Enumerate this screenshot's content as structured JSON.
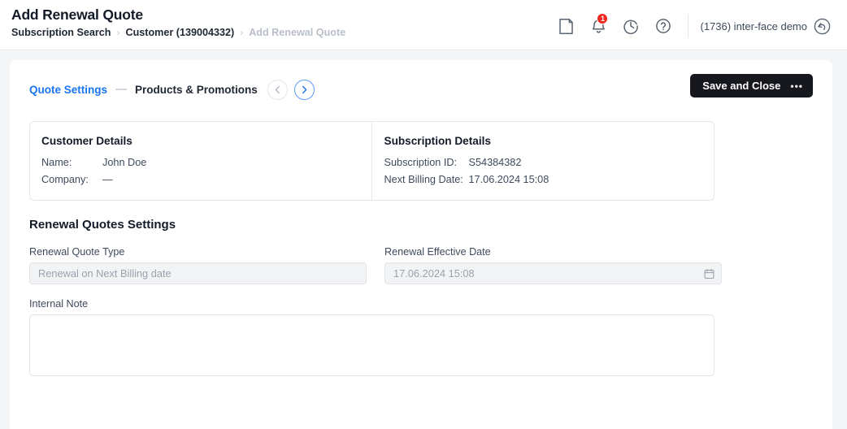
{
  "header": {
    "title": "Add Renewal Quote",
    "breadcrumb": [
      {
        "label": "Subscription Search",
        "muted": false
      },
      {
        "label": "Customer (139004332)",
        "muted": false
      },
      {
        "label": "Add Renewal Quote",
        "muted": true
      }
    ],
    "separator": "›",
    "icons": [
      {
        "name": "note-icon"
      },
      {
        "name": "bell-icon",
        "badge": "1"
      },
      {
        "name": "history-clock-icon"
      },
      {
        "name": "help-circle-icon"
      }
    ],
    "user": {
      "label": "(1736) inter-face demo",
      "logout_icon": "back-arrow-circle-icon"
    },
    "badge_color": "#f0271f"
  },
  "wizard": {
    "steps": [
      {
        "label": "Quote Settings",
        "active": true
      },
      {
        "label": "Products & Promotions",
        "active": false
      }
    ],
    "prev_button": {
      "name": "prev-step-button",
      "enabled": false
    },
    "next_button": {
      "name": "next-step-button",
      "enabled": true
    },
    "accent_color": "#1976f0"
  },
  "toolbar": {
    "save_label": "Save and Close",
    "more_dots": "•••"
  },
  "details": {
    "customer": {
      "heading": "Customer Details",
      "rows": [
        {
          "label": "Name:",
          "value": "John Doe"
        },
        {
          "label": "Company:",
          "value": "—"
        }
      ]
    },
    "subscription": {
      "heading": "Subscription Details",
      "rows": [
        {
          "label": "Subscription ID:",
          "value": "S54384382"
        },
        {
          "label": "Next Billing Date:",
          "value": "17.06.2024 15:08"
        }
      ]
    }
  },
  "settings": {
    "section_title": "Renewal Quotes Settings",
    "quote_type": {
      "label": "Renewal Quote Type",
      "value": "Renewal on Next Billing date",
      "placeholder": "Renewal on Next Billing date"
    },
    "effective_date": {
      "label": "Renewal Effective Date",
      "value": "17.06.2024 15:08",
      "placeholder": "17.06.2024 15:08"
    },
    "internal_note": {
      "label": "Internal Note",
      "value": "",
      "placeholder": ""
    }
  }
}
